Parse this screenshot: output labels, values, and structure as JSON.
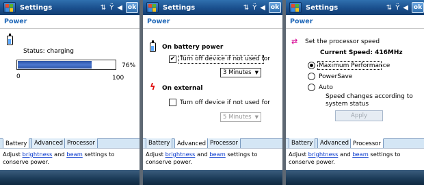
{
  "header": {
    "title": "Settings",
    "ok": "ok",
    "page": "Power"
  },
  "battery_tab": {
    "status": "Status: charging",
    "percent_label": "76%",
    "percent": 76,
    "min": "0",
    "max": "100"
  },
  "advanced_tab": {
    "battery_title": "On battery power",
    "battery_turnoff": "Turn off device if not used for",
    "battery_minutes": "3 Minutes",
    "battery_turnoff_checked": true,
    "external_title": "On external",
    "external_turnoff": "Turn off device if not used for",
    "external_minutes": "5 Minutes",
    "external_turnoff_checked": false
  },
  "processor_tab": {
    "set_speed": "Set the processor speed",
    "current_speed": "Current Speed: 416MHz",
    "options": [
      "Maximum Performance",
      "PowerSave",
      "Auto"
    ],
    "selected": "Maximum Performance",
    "auto_note_line1": "Speed changes according to",
    "auto_note_line2": "system status",
    "apply": "Apply"
  },
  "tabs": [
    "Battery",
    "Advanced",
    "Processor"
  ],
  "footer": {
    "prefix": "Adjust ",
    "brightness": "brightness",
    "and": " and ",
    "beam": "beam",
    "suffix": " settings to",
    "line2": "conserve power."
  }
}
